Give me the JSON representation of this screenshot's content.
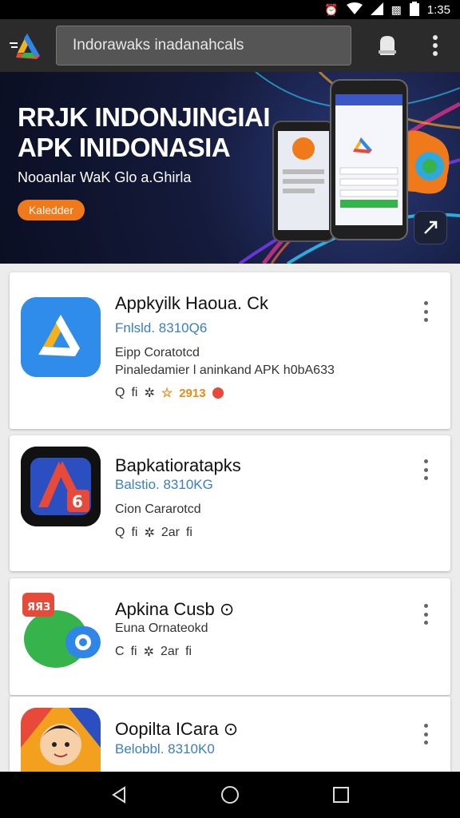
{
  "status_bar": {
    "time": "1:35",
    "icons": [
      "alarm-icon",
      "wifi-icon",
      "signal-icon",
      "nfc-icon",
      "battery-icon"
    ]
  },
  "app_bar": {
    "search_text": "Indorawaks inadanahcals",
    "icons": [
      "logo-icon",
      "notification-icon",
      "more-vert-icon"
    ]
  },
  "banner": {
    "title_line1": "RRJK INDONJINGIAI",
    "title_line2": "APK INIDONASIA",
    "subtitle": "Nooanlar WaK Glo a.Ghirla",
    "button_label": "Kaledder",
    "accent_color": "#f07a1a"
  },
  "apps": [
    {
      "name": "Appkyilk Haoua. Ck",
      "sub": "Fnlsld. 8310Q6",
      "line1": "Eipp Coratotcd",
      "line2": "Pinaledamier l aninkand APK h0bA633",
      "meta": [
        "Q",
        "fi",
        "✲",
        "☆"
      ],
      "rating": "2913"
    },
    {
      "name": "Bapkatioratapks",
      "sub": "Balstio. 8310KG",
      "line1": "Cion Cararotcd",
      "line2": "",
      "meta": [
        "Q",
        "fi",
        "✲",
        "2ar",
        "fi"
      ],
      "rating": ""
    },
    {
      "name": "Apkina Cusb ⊙",
      "sub": "",
      "line1": "Euna Ornateokd",
      "line2": "",
      "meta": [
        "C",
        "fi",
        "✲",
        "2ar",
        "fi"
      ],
      "rating": ""
    },
    {
      "name": "Oopilta ICara ⊙",
      "sub": "Belobbl. 8310K0",
      "line1": "",
      "line2": "",
      "meta": [],
      "rating": ""
    }
  ],
  "nav_bar": {
    "icons": [
      "back-icon",
      "home-icon",
      "recents-icon"
    ]
  }
}
